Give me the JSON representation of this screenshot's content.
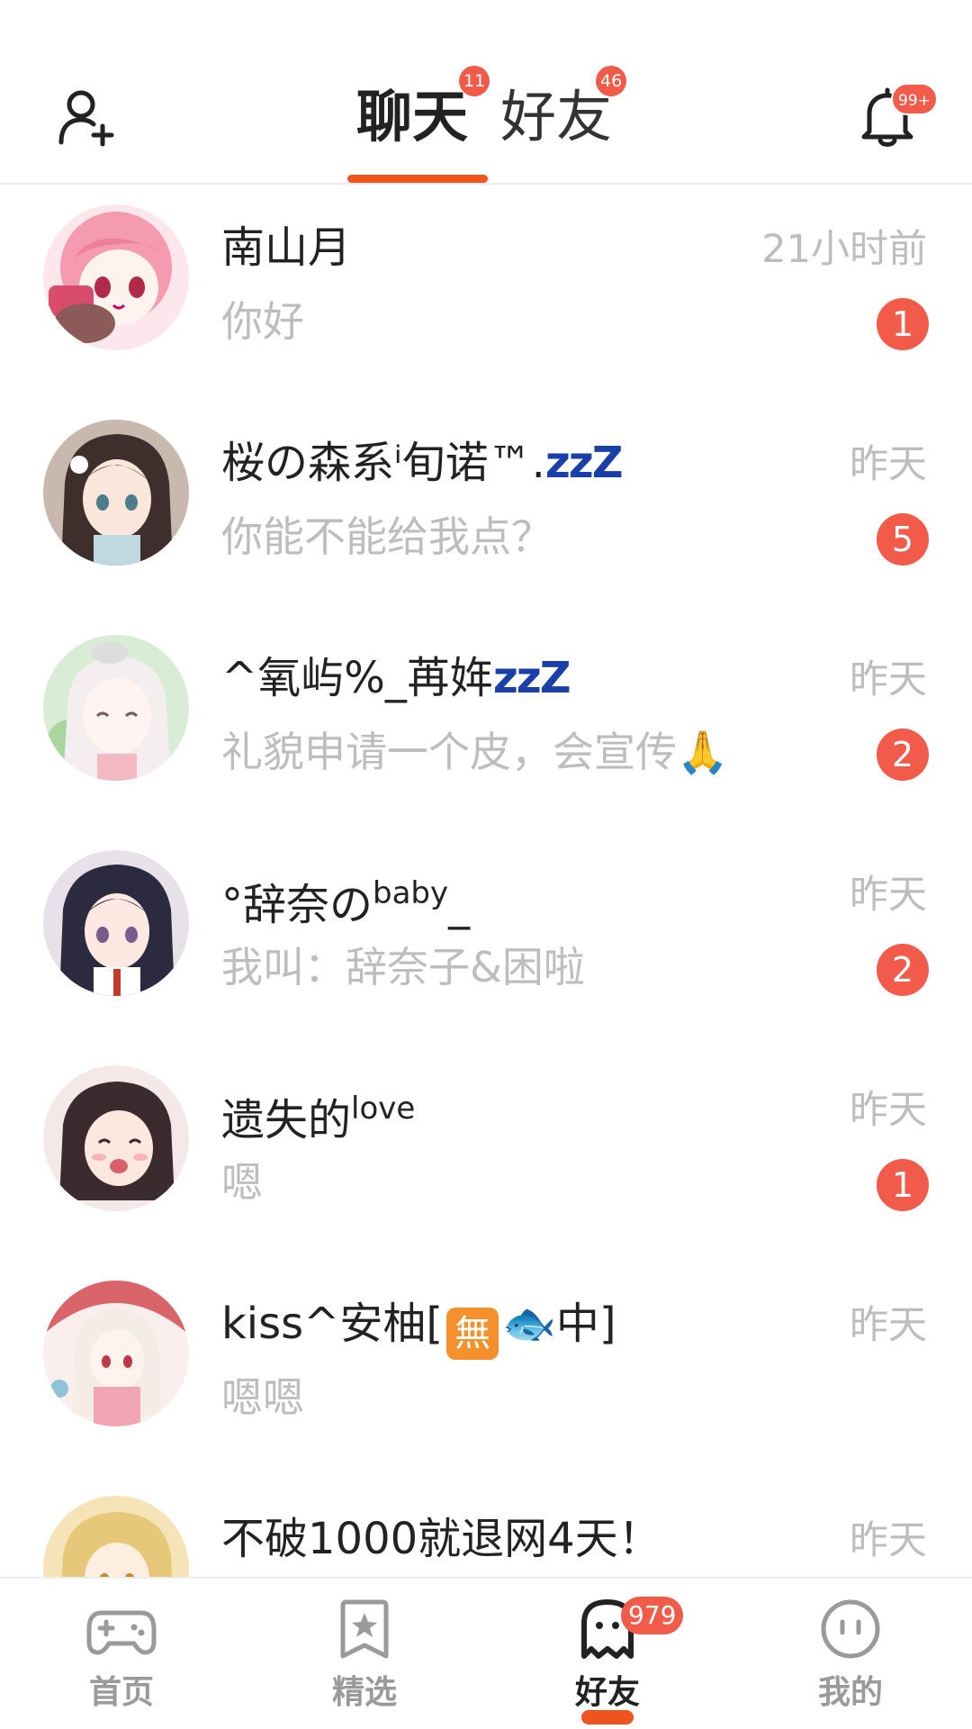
{
  "header": {
    "tabs": [
      {
        "label": "聊天",
        "badge": "11",
        "active": true
      },
      {
        "label": "好友",
        "badge": "46",
        "active": false
      }
    ],
    "notification_badge": "99+",
    "accent_color": "#f0541e",
    "badge_color": "#f25a4a"
  },
  "conversations": [
    {
      "name": "南山月",
      "time": "21小时前",
      "preview": "你好",
      "unread": "1"
    },
    {
      "name_main": "桜の森系ⁱ旬诺™.",
      "name_zzz": "zzZ",
      "time": "昨天",
      "preview": "你能不能给我点？",
      "unread": "5"
    },
    {
      "name_main": "^氧屿%_苒姩",
      "name_zzz": "zzZ",
      "time": "昨天",
      "preview": "礼貌申请一个皮，会宣传",
      "preview_emoji": "🙏",
      "unread": "2"
    },
    {
      "name_main": "°辞奈の",
      "name_sup": "baby",
      "name_end": "_",
      "time": "昨天",
      "preview": "我叫：辞奈子&困啦",
      "unread": "2"
    },
    {
      "name_main": "遗失的",
      "name_sup": "love",
      "time": "昨天",
      "preview": "嗯",
      "unread": "1"
    },
    {
      "name_start": "kiss^安柚[",
      "name_box": "無",
      "name_fish": "🐟",
      "name_end": "中]",
      "time": "昨天",
      "preview": "嗯嗯",
      "unread": ""
    },
    {
      "name": "不破1000就退网4天！",
      "time": "昨天",
      "preview": "",
      "unread": ""
    }
  ],
  "bottom_nav": [
    {
      "label": "首页",
      "icon": "gamepad-icon"
    },
    {
      "label": "精选",
      "icon": "star-bookmark-icon"
    },
    {
      "label": "好友",
      "icon": "ghost-icon",
      "badge": "979",
      "active": true
    },
    {
      "label": "我的",
      "icon": "face-icon"
    }
  ]
}
